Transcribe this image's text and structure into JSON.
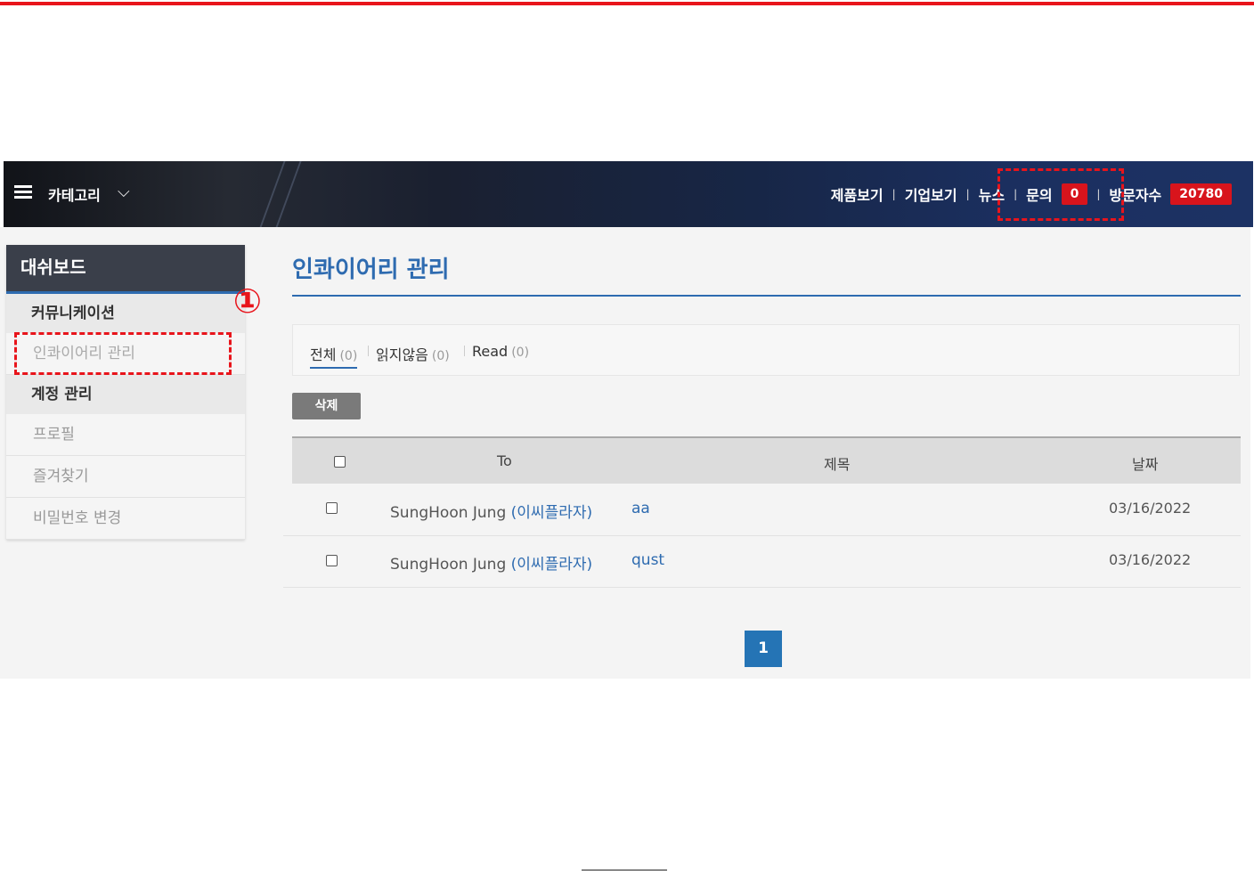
{
  "header": {
    "category_label": "카테고리",
    "nav": [
      {
        "label": "제품보기"
      },
      {
        "label": "기업보기"
      },
      {
        "label": "뉴스"
      },
      {
        "label": "문의",
        "badge": "0"
      },
      {
        "label": "방문자수",
        "badge": "20780"
      }
    ]
  },
  "sidebar": {
    "title": "대쉬보드",
    "sections": [
      {
        "label": "커뮤니케이션",
        "items": [
          {
            "label": "인콰이어리 관리"
          }
        ]
      },
      {
        "label": "계정 관리",
        "items": [
          {
            "label": "프로필"
          },
          {
            "label": "즐겨찾기"
          },
          {
            "label": "비밀번호 변경"
          }
        ]
      }
    ]
  },
  "annotation": {
    "step": "①"
  },
  "main": {
    "title": "인콰이어리 관리",
    "filters": [
      {
        "label": "전체",
        "count": "(0)"
      },
      {
        "label": "읽지않음",
        "count": "(0)"
      },
      {
        "label": "Read",
        "count": "(0)"
      }
    ],
    "delete_label": "삭제",
    "columns": {
      "to": "To",
      "subject": "제목",
      "date": "날짜"
    },
    "rows": [
      {
        "name": "SungHoon Jung",
        "org": "(이씨플라자)",
        "subject": "aa",
        "date": "03/16/2022"
      },
      {
        "name": "SungHoon Jung",
        "org": "(이씨플라자)",
        "subject": "qust",
        "date": "03/16/2022"
      }
    ],
    "page": "1"
  },
  "colors": {
    "accent": "#2e6bb0",
    "highlight": "#e8141b",
    "badge": "#d8141c"
  }
}
